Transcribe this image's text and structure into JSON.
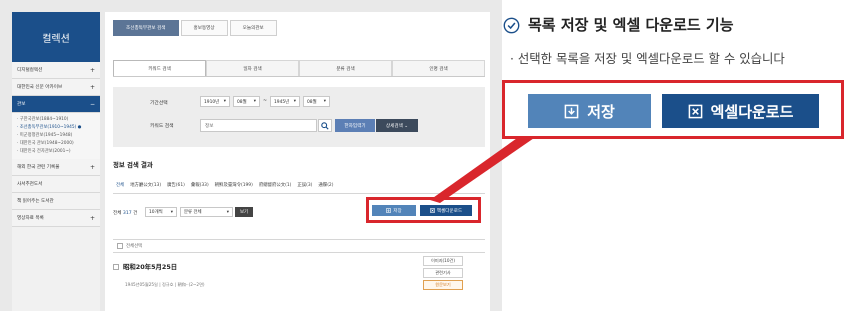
{
  "sidebar": {
    "header": "컬렉션",
    "items": [
      {
        "label": "디지털컬렉션",
        "toggle": "+"
      },
      {
        "label": "대한민국 신문 아카이브",
        "toggle": "+"
      },
      {
        "label": "관보",
        "toggle": "−"
      }
    ],
    "sub_items": [
      "· 구한국관보(1884~1910)",
      "· 조선총독부관보(1910~1945) ●",
      "· 미군정청관보(1945~1948)",
      "· 대한민국 관보(1948~2000)",
      "· 대한민국 전자관보(2001~)"
    ],
    "items_after": [
      {
        "label": "해외 한국 관련 기록물",
        "toggle": "+"
      },
      {
        "label": "사서추천도서",
        "toggle": ""
      },
      {
        "label": "책 읽어주는 도서관",
        "toggle": ""
      },
      {
        "label": "영상자료 목록",
        "toggle": "+"
      }
    ]
  },
  "top_tabs": [
    "조선총독부관보 검색",
    "홍보동영상",
    "오늘의관보"
  ],
  "search_tabs": [
    "키워드 검색",
    "일자 검색",
    "분류 검색",
    "인명 검색"
  ],
  "search": {
    "period_label": "기간선택",
    "from_year": "1910년",
    "from_month": "08월",
    "tilde": "~",
    "to_year": "1945년",
    "to_month": "08월",
    "keyword_label": "키워드 검색",
    "keyword_value": "정보",
    "hanja_button": "한자입력기",
    "detail_button": "상세검색 ⌄"
  },
  "results": {
    "title": "정보 검색 결과",
    "categories": [
      "전체",
      "地方廳公文(13)",
      "廣告(61)",
      "彙報(33)",
      "朝鮮及臺灣令(199)",
      "府總督府公文(1)",
      "正誤(3)",
      "通牒(2)"
    ],
    "total_prefix": "전체",
    "total_count": "317",
    "total_suffix": "건",
    "per_page": "10개씩",
    "sort": "분류 전체",
    "view_button": "보기",
    "save_button": "저장",
    "excel_button": "엑셀다운로드",
    "select_all": "전체선택"
  },
  "record": {
    "title": "昭和20年5月25日",
    "meta": "1945년05월25일  |  정규호  |  朝和··(2~2면)",
    "buttons": [
      "이미지(10건)",
      "관련기사",
      "원문보기"
    ]
  },
  "callout": {
    "title": "목록 저장 및 엑셀 다운로드 기능",
    "description": "·  선택한 목록을 저장 및 엑셀다운로드 할 수 있습니다",
    "save_label": "저장",
    "excel_label": "엑셀다운로드"
  },
  "colors": {
    "brand_blue": "#1b4f8a",
    "light_blue": "#5284b9",
    "highlight_red": "#d9262c"
  }
}
